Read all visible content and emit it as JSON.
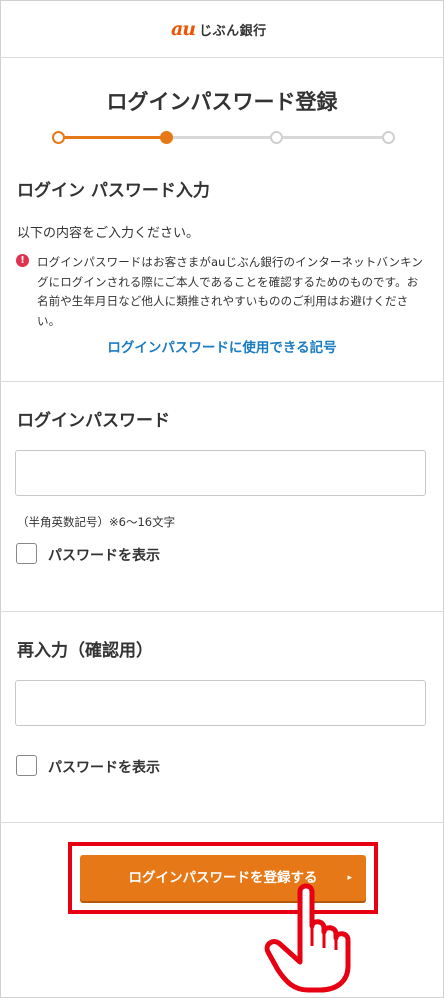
{
  "header": {
    "logo_au": "au",
    "logo_bank": "じぶん銀行"
  },
  "page": {
    "title": "ログインパスワード登録"
  },
  "stepper": {
    "steps": 4,
    "current_step": 2,
    "active_color": "#e77817",
    "inactive_color": "#d8d8d8"
  },
  "section_input": {
    "title": "ログイン パスワード入力",
    "instruction": "以下の内容をご入力ください。",
    "notice_icon": "!",
    "notice": "ログインパスワードはお客さまがauじぶん銀行のインターネットバンキングにログインされる際にご本人であることを確認するためのものです。お名前や生年月日など他人に類推されやすいもののご利用はお避けください。",
    "link": "ログインパスワードに使用できる記号"
  },
  "password_field": {
    "title": "ログインパスワード",
    "value": "",
    "hint": "（半角英数記号）※6〜16文字",
    "show_password_label": "パスワードを表示",
    "show_password_checked": false
  },
  "confirm_field": {
    "title": "再入力（確認用）",
    "value": "",
    "show_password_label": "パスワードを表示",
    "show_password_checked": false
  },
  "submit": {
    "label": "ログインパスワードを登録する",
    "arrow": "▸"
  },
  "colors": {
    "accent": "#e77817",
    "link": "#1a7cc1",
    "highlight": "#e60012",
    "alert": "#e0324c"
  }
}
